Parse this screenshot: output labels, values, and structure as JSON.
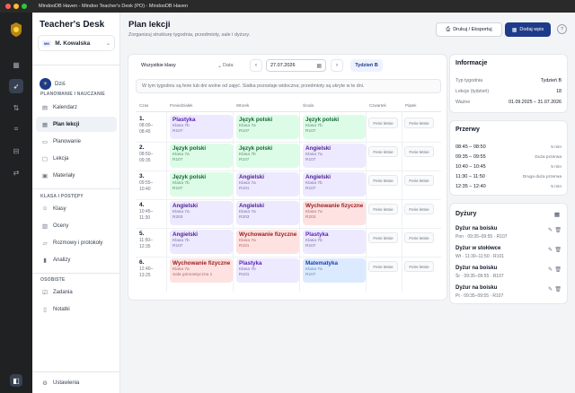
{
  "window": {
    "title": "MindooDB Haven - Mindoo Teacher's Desk (PO) - MindooDB Haven"
  },
  "sidebar": {
    "brand": "Teacher's Desk",
    "user": {
      "badge": "MK",
      "name": "M. Kowalska"
    },
    "dzis": "Dziś",
    "sections": [
      {
        "title": "PLANOWANIE I NAUCZANIE",
        "items": [
          {
            "label": "Kalendarz",
            "icon": "calendar-icon"
          },
          {
            "label": "Plan lekcji",
            "icon": "timetable-icon",
            "active": true
          },
          {
            "label": "Planowanie",
            "icon": "planning-icon"
          },
          {
            "label": "Lekcja",
            "icon": "lesson-icon"
          },
          {
            "label": "Materiały",
            "icon": "materials-icon"
          }
        ]
      },
      {
        "title": "KLASA I POSTĘPY",
        "items": [
          {
            "label": "Klasy",
            "icon": "classes-icon"
          },
          {
            "label": "Oceny",
            "icon": "grades-icon"
          },
          {
            "label": "Rozmowy i protokoły",
            "icon": "conversations-icon"
          },
          {
            "label": "Analizy",
            "icon": "analytics-icon"
          }
        ]
      },
      {
        "title": "OSOBISTE",
        "items": [
          {
            "label": "Zadania",
            "icon": "tasks-icon"
          },
          {
            "label": "Notatki",
            "icon": "notes-icon"
          }
        ]
      }
    ],
    "settings": "Ustawienia"
  },
  "header": {
    "title": "Plan lekcji",
    "subtitle": "Zorganizuj strukturę tygodnia, przedmioty, sale i dyżury.",
    "print_label": "Drukuj / Eksportuj",
    "add_label": "Dodaj wpis",
    "help": "?"
  },
  "toolbar": {
    "class_select": "Wszystkie klasy",
    "date_label": "Data",
    "date_value": "27.07.2026",
    "prev": "‹",
    "next": "›",
    "week": "Tydzień B"
  },
  "notice": "W tym tygodniu są ferie lub dni wolne od zajęć. Siatka pozostaje widoczna; przedmioty są ukryte w te dni.",
  "timetable": {
    "headers": [
      "Czas",
      "Poniedziałek",
      "Wtorek",
      "Środa",
      "Czwartek",
      "Piątek"
    ],
    "ferie_label": "Ferie letnie",
    "rows": [
      {
        "no": "1.",
        "start": "08:00–",
        "end": "08:45",
        "cells": [
          {
            "subject": "Plastyka",
            "cls": "Klasa 7b",
            "room": "R107",
            "kind": "plastyka"
          },
          {
            "subject": "Język polski",
            "cls": "Klasa 7a",
            "room": "R107",
            "kind": "polski"
          },
          {
            "subject": "Język polski",
            "cls": "Klasa 7b",
            "room": "R107",
            "kind": "polski"
          }
        ]
      },
      {
        "no": "2.",
        "start": "08:50–",
        "end": "09:35",
        "cells": [
          {
            "subject": "Język polski",
            "cls": "Klasa 7a",
            "room": "R107",
            "kind": "polski"
          },
          {
            "subject": "Język polski",
            "cls": "Klasa 7b",
            "room": "R107",
            "kind": "polski"
          },
          {
            "subject": "Angielski",
            "cls": "Klasa 7a",
            "room": "R107",
            "kind": "angielski"
          }
        ]
      },
      {
        "no": "3.",
        "start": "09:55–",
        "end": "10:40",
        "cells": [
          {
            "subject": "Język polski",
            "cls": "Klasa 7b",
            "room": "R107",
            "kind": "polski"
          },
          {
            "subject": "Angielski",
            "cls": "Klasa 7a",
            "room": "R101",
            "kind": "angielski"
          },
          {
            "subject": "Angielski",
            "cls": "Klasa 7b",
            "room": "R107",
            "kind": "angielski"
          }
        ]
      },
      {
        "no": "4.",
        "start": "10:45–",
        "end": "11:30",
        "cells": [
          {
            "subject": "Angielski",
            "cls": "Klasa 7a",
            "room": "R203",
            "kind": "angielski"
          },
          {
            "subject": "Angielski",
            "cls": "Klasa 7a",
            "room": "R203",
            "kind": "angielski"
          },
          {
            "subject": "Wychowanie fizyczne",
            "cls": "Klasa 7a",
            "room": "R203",
            "kind": "wf"
          }
        ]
      },
      {
        "no": "5.",
        "start": "11:50–",
        "end": "12:35",
        "cells": [
          {
            "subject": "Angielski",
            "cls": "Klasa 7b",
            "room": "R107",
            "kind": "angielski"
          },
          {
            "subject": "Wychowanie fizyczne",
            "cls": "Klasa 7a",
            "room": "R101",
            "kind": "wf"
          },
          {
            "subject": "Plastyka",
            "cls": "Klasa 7b",
            "room": "R107",
            "kind": "plastyka"
          }
        ]
      },
      {
        "no": "6.",
        "start": "12:40–",
        "end": "13:25",
        "cells": [
          {
            "subject": "Wychowanie fizyczne",
            "cls": "Klasa 7a",
            "room": "Sala gimnastyczna 1",
            "kind": "wf"
          },
          {
            "subject": "Plastyka",
            "cls": "Klasa 7b",
            "room": "R101",
            "kind": "plastyka"
          },
          {
            "subject": "Matematyka",
            "cls": "Klasa 7a",
            "room": "R107",
            "kind": "mat"
          }
        ]
      }
    ]
  },
  "info": {
    "title": "Informacje",
    "rows": [
      {
        "label": "Typ tygodnia",
        "value": "Tydzień B"
      },
      {
        "label": "Lekcje (tydzień)",
        "value": "18"
      },
      {
        "label": "Ważne",
        "value": "01.09.2025 – 31.07.2026"
      }
    ]
  },
  "breaks": {
    "title": "Przerwy",
    "rows": [
      {
        "time": "08:45 – 08:50",
        "desc": "5 min"
      },
      {
        "time": "09:35 – 09:55",
        "desc": "Duża przerwa"
      },
      {
        "time": "10:40 – 10:45",
        "desc": "5 min"
      },
      {
        "time": "11:30 – 11:50",
        "desc": "Druga duża przerwa"
      },
      {
        "time": "12:35 – 12:40",
        "desc": "5 min"
      }
    ]
  },
  "duties": {
    "title": "Dyżury",
    "rows": [
      {
        "title": "Dyżur na boisku",
        "sub": "Pon · 09:35–09:55 · R107"
      },
      {
        "title": "Dyżur w stołówce",
        "sub": "Wt · 11:30–11:50 · R101"
      },
      {
        "title": "Dyżur na boisku",
        "sub": "Śr · 09:35–09:55 · R107"
      },
      {
        "title": "Dyżur na boisku",
        "sub": "Pt · 09:35–09:55 · R107"
      }
    ]
  },
  "colors": {
    "accent": "#1e3a8a",
    "rail": "#202123"
  }
}
